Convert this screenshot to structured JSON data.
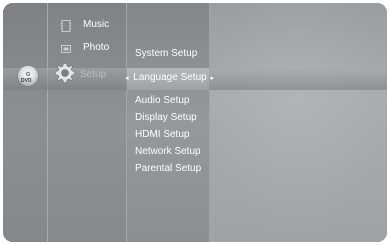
{
  "main_menu": {
    "items": [
      {
        "label": "Music",
        "icon": "film-strip-icon"
      },
      {
        "label": "Photo",
        "icon": "photo-frame-icon"
      },
      {
        "label": "Setup",
        "icon": "gear-icon"
      }
    ]
  },
  "disc_badge": "DVD",
  "setup_menu": {
    "items": [
      "System Setup",
      "Language Setup",
      "Audio Setup",
      "Display Setup",
      "HDMI Setup",
      "Network Setup",
      "Parental Setup"
    ],
    "selected_index": 1,
    "left_arrow": "◂",
    "right_arrow": "▸"
  },
  "colors": {
    "text": "#ffffff",
    "dim_text": "#b9bcc0",
    "panel": "#8e9195"
  }
}
